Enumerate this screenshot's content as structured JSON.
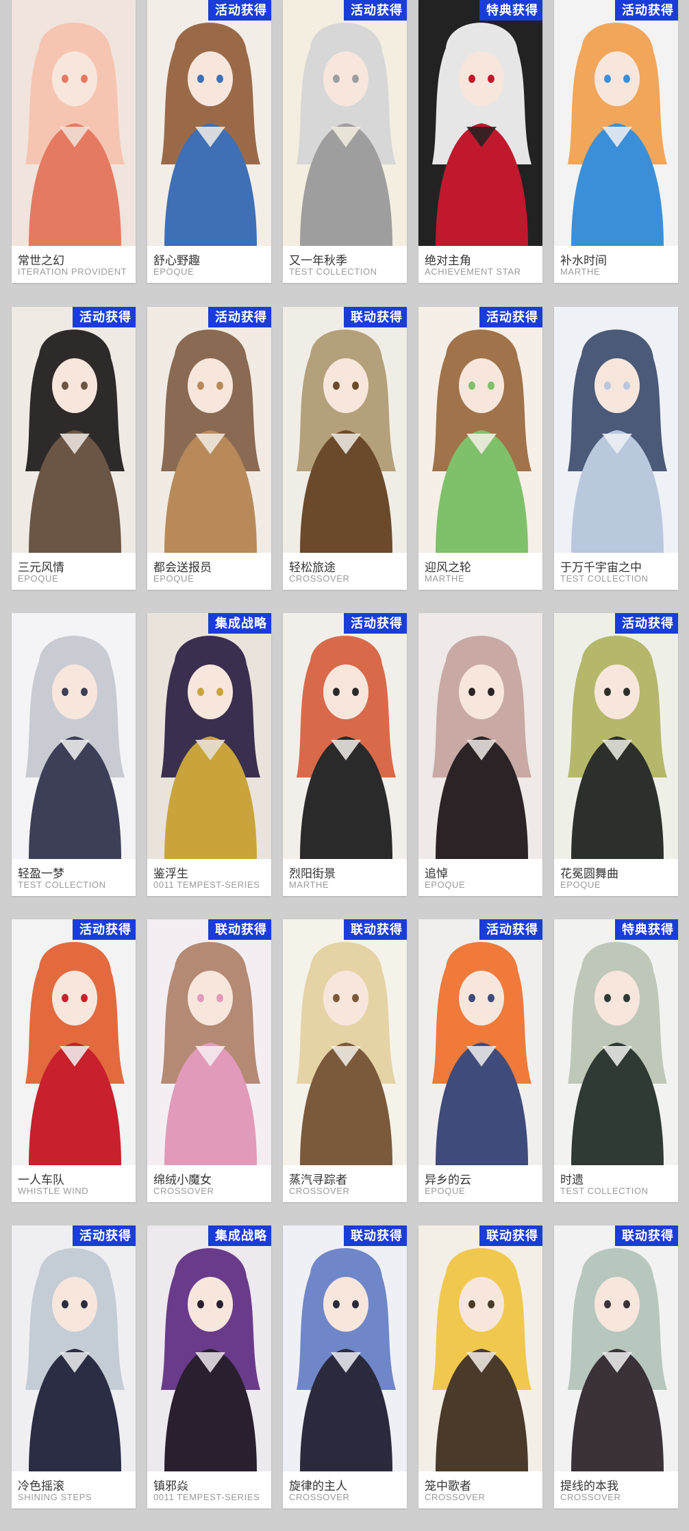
{
  "colors": {
    "page_background": "#cfcfcf",
    "badge_background": "#1a3cd9",
    "badge_text": "#ffffff",
    "title_text": "#333333",
    "subtitle_text": "#9a9a9a"
  },
  "cards": [
    {
      "title": "常世之幻",
      "subtitle": "ITERATION PROVIDENT",
      "badge": "",
      "art_colors": [
        "#f6c5b2",
        "#e57a62",
        "#f1e4dc"
      ]
    },
    {
      "title": "舒心野趣",
      "subtitle": "EPOQUE",
      "badge": "活动获得",
      "art_colors": [
        "#9a6a48",
        "#3f6fb5",
        "#f2ede6"
      ]
    },
    {
      "title": "又一年秋季",
      "subtitle": "TEST COLLECTION",
      "badge": "活动获得",
      "art_colors": [
        "#d7d7d7",
        "#9e9e9e",
        "#f3eee0"
      ]
    },
    {
      "title": "绝对主角",
      "subtitle": "ACHIEVEMENT STAR",
      "badge": "特典获得",
      "art_colors": [
        "#e6e6e6",
        "#c0182d",
        "#222222"
      ]
    },
    {
      "title": "补水时间",
      "subtitle": "MARTHE",
      "badge": "活动获得",
      "art_colors": [
        "#f2a65a",
        "#3b8fd9",
        "#f3f3f3"
      ]
    },
    {
      "title": "三元风情",
      "subtitle": "EPOQUE",
      "badge": "活动获得",
      "art_colors": [
        "#2f2a2a",
        "#6b5544",
        "#efeae4"
      ]
    },
    {
      "title": "都会送报员",
      "subtitle": "EPOQUE",
      "badge": "活动获得",
      "art_colors": [
        "#8a6a52",
        "#b88a5a",
        "#f1ebe4"
      ]
    },
    {
      "title": "轻松旅途",
      "subtitle": "CROSSOVER",
      "badge": "联动获得",
      "art_colors": [
        "#b4a07a",
        "#6b4a2b",
        "#f0ede6"
      ]
    },
    {
      "title": "迎风之轮",
      "subtitle": "MARTHE",
      "badge": "活动获得",
      "art_colors": [
        "#a0734a",
        "#7fc06a",
        "#f6efe7"
      ]
    },
    {
      "title": "于万千宇宙之中",
      "subtitle": "TEST COLLECTION",
      "badge": "",
      "art_colors": [
        "#4a5a78",
        "#b9c8dd",
        "#eef1f6"
      ]
    },
    {
      "title": "轻盈一梦",
      "subtitle": "TEST COLLECTION",
      "badge": "",
      "art_colors": [
        "#c9cbd3",
        "#3c3f57",
        "#f4f4f6"
      ]
    },
    {
      "title": "鉴浮生",
      "subtitle": "0011 TEMPEST-SERIES",
      "badge": "集成战略",
      "art_colors": [
        "#3b2f4f",
        "#c9a43a",
        "#e9e3dc"
      ]
    },
    {
      "title": "烈阳街景",
      "subtitle": "MARTHE",
      "badge": "活动获得",
      "art_colors": [
        "#d86a4a",
        "#2a2a2a",
        "#f2efea"
      ]
    },
    {
      "title": "追悼",
      "subtitle": "EPOQUE",
      "badge": "",
      "art_colors": [
        "#c8a9a4",
        "#2b2326",
        "#efe9e7"
      ]
    },
    {
      "title": "花冕圆舞曲",
      "subtitle": "EPOQUE",
      "badge": "活动获得",
      "art_colors": [
        "#b5b86a",
        "#2d2f2a",
        "#eef0e8"
      ]
    },
    {
      "title": "一人车队",
      "subtitle": "WHISTLE WIND",
      "badge": "活动获得",
      "art_colors": [
        "#e26a3e",
        "#c8202c",
        "#f3f3f3"
      ]
    },
    {
      "title": "绵绒小魔女",
      "subtitle": "CROSSOVER",
      "badge": "联动获得",
      "art_colors": [
        "#b48a74",
        "#e19ab9",
        "#f4eef2"
      ]
    },
    {
      "title": "蒸汽寻踪者",
      "subtitle": "CROSSOVER",
      "badge": "联动获得",
      "art_colors": [
        "#e5d3a6",
        "#7a5a3a",
        "#f5f2ea"
      ]
    },
    {
      "title": "异乡的云",
      "subtitle": "EPOQUE",
      "badge": "活动获得",
      "art_colors": [
        "#ef7a3a",
        "#3f4b7a",
        "#f1efee"
      ]
    },
    {
      "title": "时遗",
      "subtitle": "TEST COLLECTION",
      "badge": "特典获得",
      "art_colors": [
        "#bfc7b9",
        "#2f3a34",
        "#f2f3f0"
      ]
    },
    {
      "title": "冷色摇滚",
      "subtitle": "SHINING STEPS",
      "badge": "活动获得",
      "art_colors": [
        "#c4ccd6",
        "#2a2d44",
        "#efeff2"
      ]
    },
    {
      "title": "镇邪焱",
      "subtitle": "0011 TEMPEST-SERIES",
      "badge": "集成战略",
      "art_colors": [
        "#6a3b8a",
        "#2a1f2e",
        "#eee8ef"
      ]
    },
    {
      "title": "旋律的主人",
      "subtitle": "CROSSOVER",
      "badge": "联动获得",
      "art_colors": [
        "#6f86c9",
        "#2b2a3d",
        "#eef0f6"
      ]
    },
    {
      "title": "笼中歌者",
      "subtitle": "CROSSOVER",
      "badge": "联动获得",
      "art_colors": [
        "#f0c84e",
        "#4a3a2a",
        "#f3efe6"
      ]
    },
    {
      "title": "提线的本我",
      "subtitle": "CROSSOVER",
      "badge": "联动获得",
      "art_colors": [
        "#b8c7bd",
        "#3a3238",
        "#f2f2f2"
      ]
    }
  ]
}
